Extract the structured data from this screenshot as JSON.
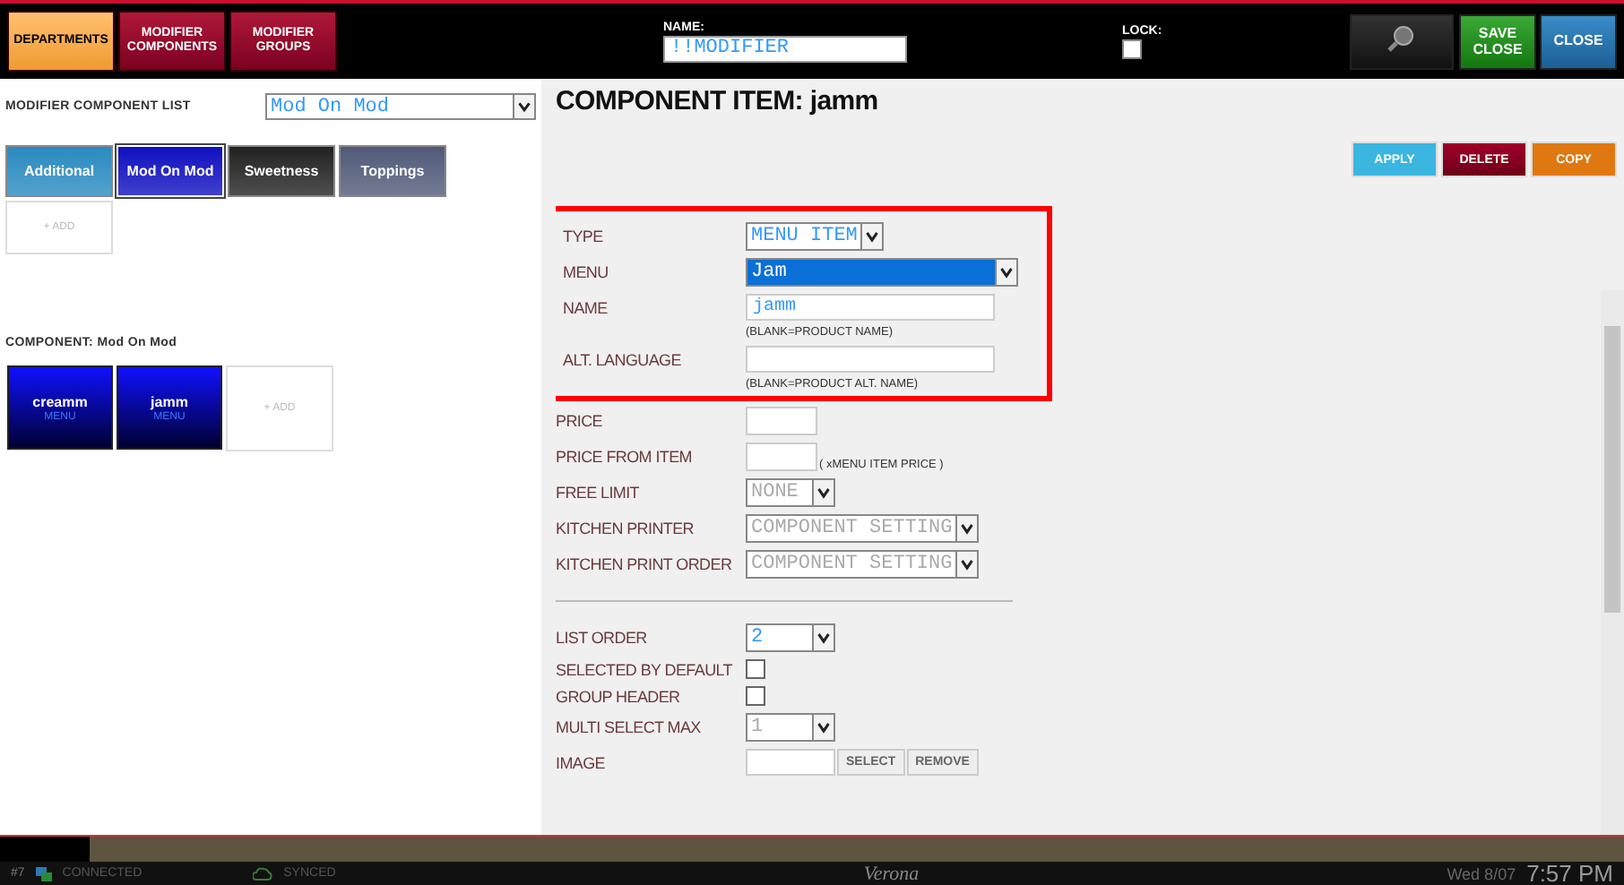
{
  "top_bar": {
    "tabs": [
      {
        "label": "DEPARTMENTS",
        "selected": true
      },
      {
        "label": "MODIFIER COMPONENTS",
        "selected": false
      },
      {
        "label": "MODIFIER GROUPS",
        "selected": false
      }
    ],
    "name_label": "NAME:",
    "name_value": "!!MODIFIER",
    "lock_label": "LOCK:",
    "lock_checked": false,
    "buttons": [
      {
        "kind": "search"
      },
      {
        "kind": "save",
        "label": "SAVE CLOSE"
      },
      {
        "kind": "close",
        "label": "CLOSE"
      }
    ]
  },
  "left_panel": {
    "list_label": "MODIFIER COMPONENT LIST",
    "list_value": "Mod On Mod",
    "groups": [
      {
        "label": "Additional",
        "color": "#2a8ac0",
        "selected": false
      },
      {
        "label": "Mod On Mod",
        "color": "#1010c0",
        "selected": true
      },
      {
        "label": "Sweetness",
        "color": "#222222",
        "selected": false
      },
      {
        "label": "Toppings",
        "color": "#505a78",
        "selected": false
      }
    ],
    "group_add": "+ ADD",
    "component_label": "COMPONENT: Mod On Mod",
    "components": [
      {
        "name": "creamm",
        "type": "MENU"
      },
      {
        "name": "jamm",
        "type": "MENU"
      }
    ],
    "component_add": "+ ADD"
  },
  "detail": {
    "title": "COMPONENT ITEM: jamm",
    "actions": [
      {
        "kind": "apply",
        "label": "APPLY"
      },
      {
        "kind": "delete",
        "label": "DELETE"
      },
      {
        "kind": "copy",
        "label": "COPY"
      }
    ],
    "highlighted_fields": [
      {
        "kind": "select",
        "label": "TYPE",
        "value": "MENU ITEM",
        "selected": false
      },
      {
        "kind": "select",
        "label": "MENU",
        "value": "Jam",
        "selected": true
      },
      {
        "kind": "text",
        "label": "NAME",
        "value": "jamm",
        "hint": "(BLANK=PRODUCT NAME)"
      },
      {
        "kind": "text",
        "label": "ALT. LANGUAGE",
        "hint": "(BLANK=PRODUCT ALT. NAME)"
      }
    ],
    "fields": [
      {
        "kind": "small",
        "label": "PRICE"
      },
      {
        "kind": "small",
        "label": "PRICE FROM ITEM",
        "suffix": "( xMENU ITEM PRICE )"
      },
      {
        "kind": "select",
        "label": "FREE LIMIT",
        "value": "NONE",
        "disabled": true
      },
      {
        "kind": "select",
        "label": "KITCHEN PRINTER",
        "value": "COMPONENT SETTING",
        "disabled": true
      },
      {
        "kind": "select",
        "label": "KITCHEN PRINT ORDER",
        "value": "COMPONENT SETTING",
        "disabled": true
      },
      {
        "kind": "divider"
      },
      {
        "kind": "select",
        "label": "LIST ORDER",
        "value": "2",
        "disabled": false
      },
      {
        "kind": "check",
        "label": "SELECTED BY DEFAULT",
        "checked": false
      },
      {
        "kind": "check",
        "label": "GROUP HEADER",
        "checked": false
      },
      {
        "kind": "select",
        "label": "MULTI SELECT MAX",
        "value": "1",
        "disabled": true
      },
      {
        "kind": "image",
        "label": "IMAGE",
        "buttons": [
          "SELECT",
          "REMOVE"
        ]
      }
    ]
  },
  "status_bar": {
    "terminal": "#7",
    "connection": "CONNECTED",
    "sync": "SYNCED",
    "venue": "Verona",
    "date": "Wed 8/07",
    "time": "7:57 PM"
  }
}
